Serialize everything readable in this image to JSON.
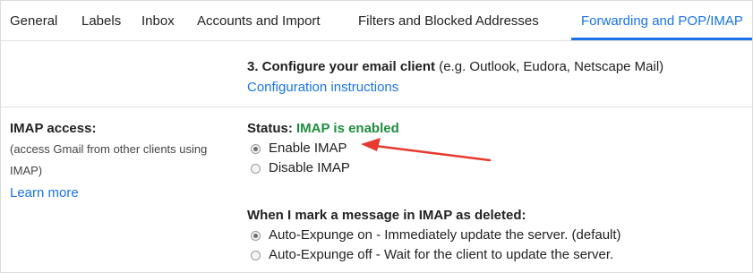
{
  "tabs": [
    "General",
    "Labels",
    "Inbox",
    "Accounts and Import",
    "Filters and Blocked Addresses",
    "Forwarding and POP/IMAP"
  ],
  "configure": {
    "heading": "3. Configure your email client",
    "hint": "(e.g. Outlook, Eudora, Netscape Mail)",
    "link": "Configuration instructions"
  },
  "imap": {
    "label": "IMAP access:",
    "desc_line1": "(access Gmail from other clients using",
    "desc_line2": "IMAP)",
    "learn_more": "Learn more",
    "status_label": "Status:",
    "status_value": "IMAP is enabled",
    "options": [
      {
        "label": "Enable IMAP",
        "checked": true
      },
      {
        "label": "Disable IMAP",
        "checked": false
      }
    ]
  },
  "deleted": {
    "heading": "When I mark a message in IMAP as deleted:",
    "options": [
      {
        "label": "Auto-Expunge on - Immediately update the server. (default)",
        "checked": true
      },
      {
        "label": "Auto-Expunge off - Wait for the client to update the server.",
        "checked": false
      }
    ]
  },
  "colors": {
    "accent": "#1a73e8",
    "status_green": "#1e8e3e",
    "annotation_arrow": "#e8392f"
  }
}
